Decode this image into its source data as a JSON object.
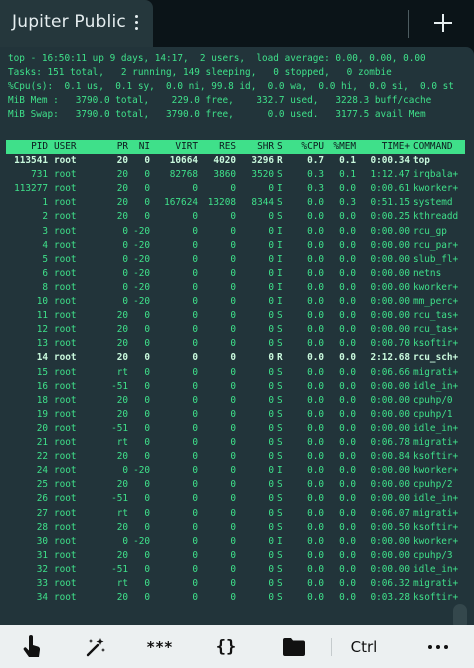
{
  "app": {
    "tab_title": "Jupiter Public",
    "menu_icon": "kebab-menu-icon",
    "new_tab_icon": "plus-icon"
  },
  "colors": {
    "terminal_bg": "#22343a",
    "terminal_fg": "#3fe08a",
    "toolbar_bg": "#ecf0f1"
  },
  "top": {
    "summary": [
      "top - 16:50:11 up 9 days, 14:17,  2 users,  load average: 0.00, 0.00, 0.00",
      "Tasks: 151 total,   2 running, 149 sleeping,   0 stopped,   0 zombie",
      "%Cpu(s):  0.1 us,  0.1 sy,  0.0 ni, 99.8 id,  0.0 wa,  0.0 hi,  0.0 si,  0.0 st",
      "MiB Mem :   3790.0 total,    229.0 free,    332.7 used,   3228.3 buff/cache",
      "MiB Swap:   3790.0 total,   3790.0 free,      0.0 used.   3177.5 avail Mem"
    ],
    "columns": [
      "PID",
      "USER",
      "PR",
      "NI",
      "VIRT",
      "RES",
      "SHR",
      "S",
      "%CPU",
      "%MEM",
      "TIME+",
      "COMMAND"
    ],
    "processes": [
      {
        "pid": "113541",
        "user": "root",
        "pr": "20",
        "ni": "0",
        "virt": "10664",
        "res": "4020",
        "shr": "3296",
        "s": "R",
        "cpu": "0.7",
        "mem": "0.1",
        "time": "0:00.34",
        "cmd": "top",
        "bold": true
      },
      {
        "pid": "731",
        "user": "root",
        "pr": "20",
        "ni": "0",
        "virt": "82768",
        "res": "3860",
        "shr": "3520",
        "s": "S",
        "cpu": "0.3",
        "mem": "0.1",
        "time": "1:12.47",
        "cmd": "irqbala+",
        "bold": false
      },
      {
        "pid": "113277",
        "user": "root",
        "pr": "20",
        "ni": "0",
        "virt": "0",
        "res": "0",
        "shr": "0",
        "s": "I",
        "cpu": "0.3",
        "mem": "0.0",
        "time": "0:00.61",
        "cmd": "kworker+",
        "bold": false
      },
      {
        "pid": "1",
        "user": "root",
        "pr": "20",
        "ni": "0",
        "virt": "167624",
        "res": "13208",
        "shr": "8344",
        "s": "S",
        "cpu": "0.0",
        "mem": "0.3",
        "time": "0:51.15",
        "cmd": "systemd",
        "bold": false
      },
      {
        "pid": "2",
        "user": "root",
        "pr": "20",
        "ni": "0",
        "virt": "0",
        "res": "0",
        "shr": "0",
        "s": "S",
        "cpu": "0.0",
        "mem": "0.0",
        "time": "0:00.25",
        "cmd": "kthreadd",
        "bold": false
      },
      {
        "pid": "3",
        "user": "root",
        "pr": "0",
        "ni": "-20",
        "virt": "0",
        "res": "0",
        "shr": "0",
        "s": "I",
        "cpu": "0.0",
        "mem": "0.0",
        "time": "0:00.00",
        "cmd": "rcu_gp",
        "bold": false
      },
      {
        "pid": "4",
        "user": "root",
        "pr": "0",
        "ni": "-20",
        "virt": "0",
        "res": "0",
        "shr": "0",
        "s": "I",
        "cpu": "0.0",
        "mem": "0.0",
        "time": "0:00.00",
        "cmd": "rcu_par+",
        "bold": false
      },
      {
        "pid": "5",
        "user": "root",
        "pr": "0",
        "ni": "-20",
        "virt": "0",
        "res": "0",
        "shr": "0",
        "s": "I",
        "cpu": "0.0",
        "mem": "0.0",
        "time": "0:00.00",
        "cmd": "slub_fl+",
        "bold": false
      },
      {
        "pid": "6",
        "user": "root",
        "pr": "0",
        "ni": "-20",
        "virt": "0",
        "res": "0",
        "shr": "0",
        "s": "I",
        "cpu": "0.0",
        "mem": "0.0",
        "time": "0:00.00",
        "cmd": "netns",
        "bold": false
      },
      {
        "pid": "8",
        "user": "root",
        "pr": "0",
        "ni": "-20",
        "virt": "0",
        "res": "0",
        "shr": "0",
        "s": "I",
        "cpu": "0.0",
        "mem": "0.0",
        "time": "0:00.00",
        "cmd": "kworker+",
        "bold": false
      },
      {
        "pid": "10",
        "user": "root",
        "pr": "0",
        "ni": "-20",
        "virt": "0",
        "res": "0",
        "shr": "0",
        "s": "I",
        "cpu": "0.0",
        "mem": "0.0",
        "time": "0:00.00",
        "cmd": "mm_perc+",
        "bold": false
      },
      {
        "pid": "11",
        "user": "root",
        "pr": "20",
        "ni": "0",
        "virt": "0",
        "res": "0",
        "shr": "0",
        "s": "S",
        "cpu": "0.0",
        "mem": "0.0",
        "time": "0:00.00",
        "cmd": "rcu_tas+",
        "bold": false
      },
      {
        "pid": "12",
        "user": "root",
        "pr": "20",
        "ni": "0",
        "virt": "0",
        "res": "0",
        "shr": "0",
        "s": "S",
        "cpu": "0.0",
        "mem": "0.0",
        "time": "0:00.00",
        "cmd": "rcu_tas+",
        "bold": false
      },
      {
        "pid": "13",
        "user": "root",
        "pr": "20",
        "ni": "0",
        "virt": "0",
        "res": "0",
        "shr": "0",
        "s": "S",
        "cpu": "0.0",
        "mem": "0.0",
        "time": "0:00.70",
        "cmd": "ksoftir+",
        "bold": false
      },
      {
        "pid": "14",
        "user": "root",
        "pr": "20",
        "ni": "0",
        "virt": "0",
        "res": "0",
        "shr": "0",
        "s": "R",
        "cpu": "0.0",
        "mem": "0.0",
        "time": "2:12.68",
        "cmd": "rcu_sch+",
        "bold": true
      },
      {
        "pid": "15",
        "user": "root",
        "pr": "rt",
        "ni": "0",
        "virt": "0",
        "res": "0",
        "shr": "0",
        "s": "S",
        "cpu": "0.0",
        "mem": "0.0",
        "time": "0:06.66",
        "cmd": "migrati+",
        "bold": false
      },
      {
        "pid": "16",
        "user": "root",
        "pr": "-51",
        "ni": "0",
        "virt": "0",
        "res": "0",
        "shr": "0",
        "s": "S",
        "cpu": "0.0",
        "mem": "0.0",
        "time": "0:00.00",
        "cmd": "idle_in+",
        "bold": false
      },
      {
        "pid": "18",
        "user": "root",
        "pr": "20",
        "ni": "0",
        "virt": "0",
        "res": "0",
        "shr": "0",
        "s": "S",
        "cpu": "0.0",
        "mem": "0.0",
        "time": "0:00.00",
        "cmd": "cpuhp/0",
        "bold": false
      },
      {
        "pid": "19",
        "user": "root",
        "pr": "20",
        "ni": "0",
        "virt": "0",
        "res": "0",
        "shr": "0",
        "s": "S",
        "cpu": "0.0",
        "mem": "0.0",
        "time": "0:00.00",
        "cmd": "cpuhp/1",
        "bold": false
      },
      {
        "pid": "20",
        "user": "root",
        "pr": "-51",
        "ni": "0",
        "virt": "0",
        "res": "0",
        "shr": "0",
        "s": "S",
        "cpu": "0.0",
        "mem": "0.0",
        "time": "0:00.00",
        "cmd": "idle_in+",
        "bold": false
      },
      {
        "pid": "21",
        "user": "root",
        "pr": "rt",
        "ni": "0",
        "virt": "0",
        "res": "0",
        "shr": "0",
        "s": "S",
        "cpu": "0.0",
        "mem": "0.0",
        "time": "0:06.78",
        "cmd": "migrati+",
        "bold": false
      },
      {
        "pid": "22",
        "user": "root",
        "pr": "20",
        "ni": "0",
        "virt": "0",
        "res": "0",
        "shr": "0",
        "s": "S",
        "cpu": "0.0",
        "mem": "0.0",
        "time": "0:00.84",
        "cmd": "ksoftir+",
        "bold": false
      },
      {
        "pid": "24",
        "user": "root",
        "pr": "0",
        "ni": "-20",
        "virt": "0",
        "res": "0",
        "shr": "0",
        "s": "I",
        "cpu": "0.0",
        "mem": "0.0",
        "time": "0:00.00",
        "cmd": "kworker+",
        "bold": false
      },
      {
        "pid": "25",
        "user": "root",
        "pr": "20",
        "ni": "0",
        "virt": "0",
        "res": "0",
        "shr": "0",
        "s": "S",
        "cpu": "0.0",
        "mem": "0.0",
        "time": "0:00.00",
        "cmd": "cpuhp/2",
        "bold": false
      },
      {
        "pid": "26",
        "user": "root",
        "pr": "-51",
        "ni": "0",
        "virt": "0",
        "res": "0",
        "shr": "0",
        "s": "S",
        "cpu": "0.0",
        "mem": "0.0",
        "time": "0:00.00",
        "cmd": "idle_in+",
        "bold": false
      },
      {
        "pid": "27",
        "user": "root",
        "pr": "rt",
        "ni": "0",
        "virt": "0",
        "res": "0",
        "shr": "0",
        "s": "S",
        "cpu": "0.0",
        "mem": "0.0",
        "time": "0:06.07",
        "cmd": "migrati+",
        "bold": false
      },
      {
        "pid": "28",
        "user": "root",
        "pr": "20",
        "ni": "0",
        "virt": "0",
        "res": "0",
        "shr": "0",
        "s": "S",
        "cpu": "0.0",
        "mem": "0.0",
        "time": "0:00.50",
        "cmd": "ksoftir+",
        "bold": false
      },
      {
        "pid": "30",
        "user": "root",
        "pr": "0",
        "ni": "-20",
        "virt": "0",
        "res": "0",
        "shr": "0",
        "s": "I",
        "cpu": "0.0",
        "mem": "0.0",
        "time": "0:00.00",
        "cmd": "kworker+",
        "bold": false
      },
      {
        "pid": "31",
        "user": "root",
        "pr": "20",
        "ni": "0",
        "virt": "0",
        "res": "0",
        "shr": "0",
        "s": "S",
        "cpu": "0.0",
        "mem": "0.0",
        "time": "0:00.00",
        "cmd": "cpuhp/3",
        "bold": false
      },
      {
        "pid": "32",
        "user": "root",
        "pr": "-51",
        "ni": "0",
        "virt": "0",
        "res": "0",
        "shr": "0",
        "s": "S",
        "cpu": "0.0",
        "mem": "0.0",
        "time": "0:00.00",
        "cmd": "idle_in+",
        "bold": false
      },
      {
        "pid": "33",
        "user": "root",
        "pr": "rt",
        "ni": "0",
        "virt": "0",
        "res": "0",
        "shr": "0",
        "s": "S",
        "cpu": "0.0",
        "mem": "0.0",
        "time": "0:06.32",
        "cmd": "migrati+",
        "bold": false
      },
      {
        "pid": "34",
        "user": "root",
        "pr": "20",
        "ni": "0",
        "virt": "0",
        "res": "0",
        "shr": "0",
        "s": "S",
        "cpu": "0.0",
        "mem": "0.0",
        "time": "0:03.28",
        "cmd": "ksoftir+",
        "bold": false
      }
    ]
  },
  "toolbar": {
    "buttons": [
      {
        "icon": "touch-hand-icon"
      },
      {
        "icon": "magic-wand-icon"
      },
      {
        "label": "***",
        "icon": "password-icon"
      },
      {
        "label": "{}",
        "icon": "snippets-braces-icon"
      },
      {
        "icon": "folder-icon"
      },
      {
        "label": "Ctrl"
      },
      {
        "icon": "more-dots-icon"
      }
    ]
  }
}
